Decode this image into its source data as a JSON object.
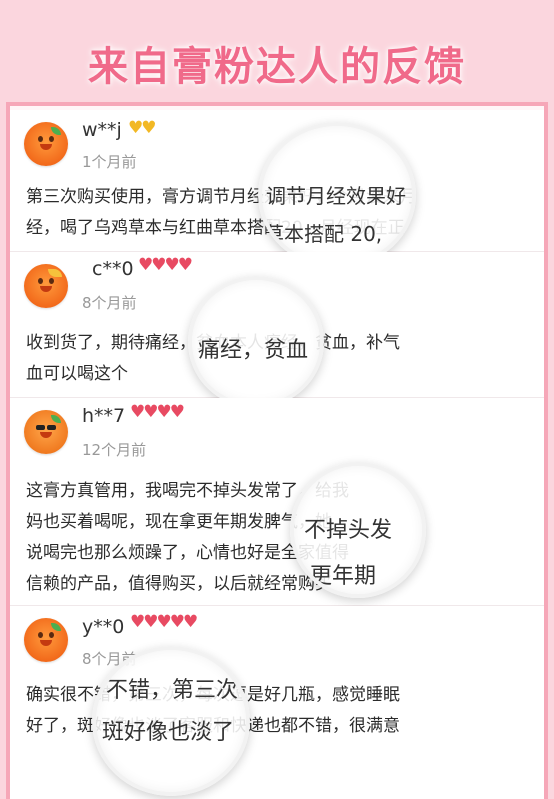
{
  "header": {
    "title": "来自膏粉达人的反馈"
  },
  "reviews": [
    {
      "user": "w**j",
      "badges": "♥♥",
      "date": "1个月前",
      "lines": [
        "第三次购买使用，膏方调节月经效果好，个月没来月",
        "经，喝了乌鸡草本与红曲草本搭配20，月经现在正"
      ],
      "magnifier": [
        "调节月经效果好",
        "草本搭配 20,"
      ]
    },
    {
      "user": "c**0",
      "badges": "♥♥♥♥",
      "date": "8个月前",
      "lines": [
        "收到货了，期待痛经，贫血本人痛经，贫血，补气",
        "血可以喝这个"
      ],
      "magnifier": [
        "痛经，贫血"
      ]
    },
    {
      "user": "h**7",
      "badges": "♥♥♥♥",
      "date": "12个月前",
      "lines": [
        "这膏方真管用，我喝完不掉头发常了，给我",
        "妈也买着喝呢，现在拿更年期发脾气，她",
        "说喝完也那么烦躁了，心情也好是全家值得",
        "信赖的产品，值得购买，以后就经常购买"
      ],
      "magnifier": [
        "不掉头发",
        "更年期"
      ]
    },
    {
      "user": "y**0",
      "badges": "♥♥♥♥♥",
      "date": "8个月前",
      "lines": [
        "确实很不错，第三次，每次逗是好几瓶，感觉睡眠",
        "好了，斑好像也淡了客服和快递也都不错，很满意"
      ],
      "magnifier": [
        "不错，第三次",
        "斑好像也淡了"
      ]
    }
  ]
}
